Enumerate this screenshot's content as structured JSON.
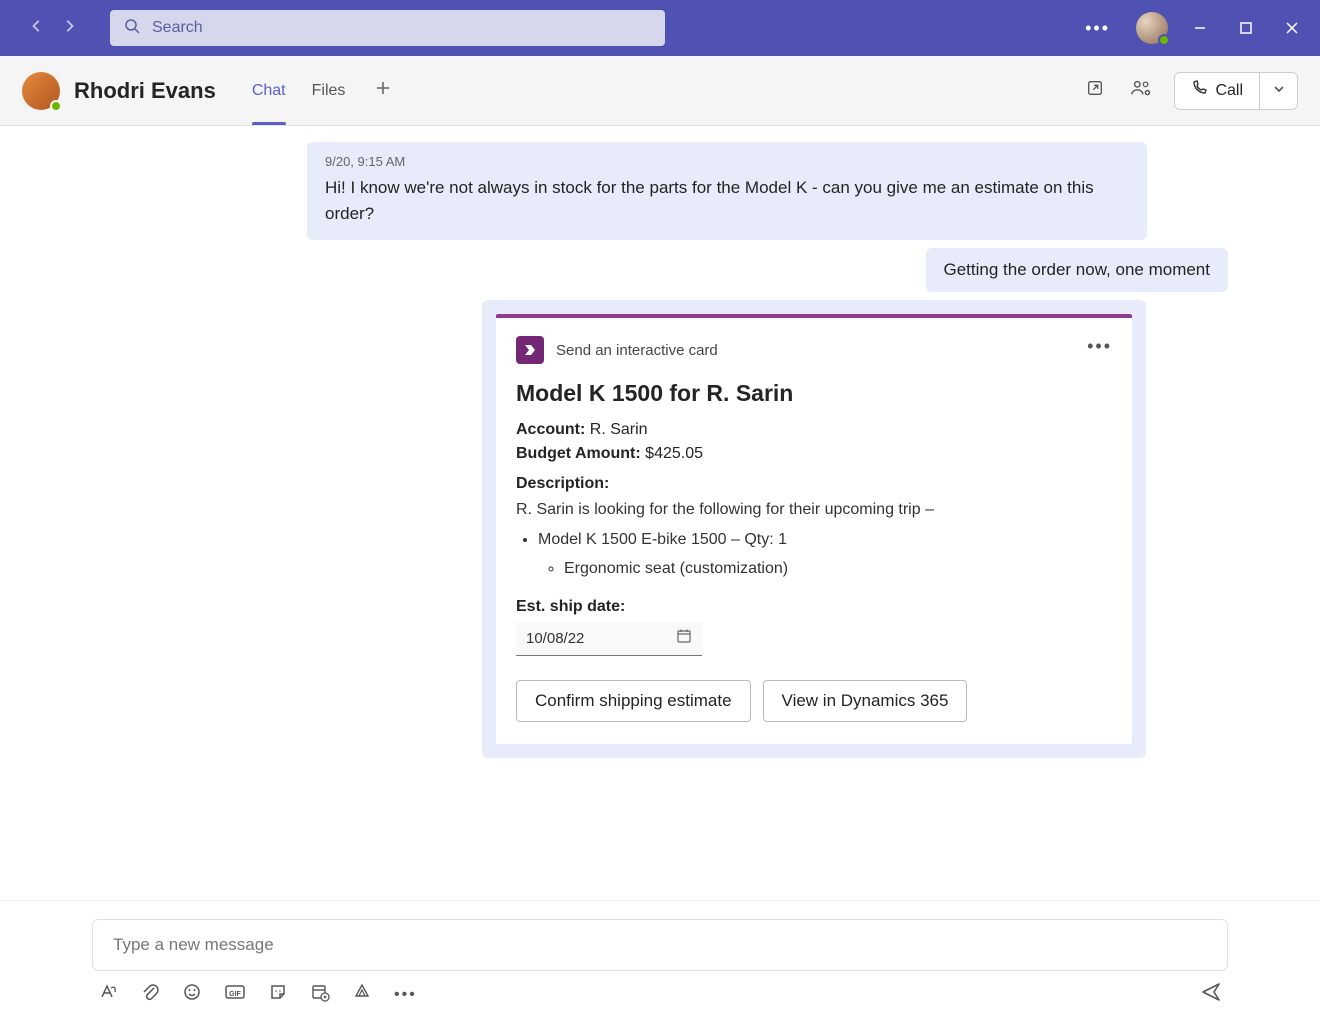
{
  "titlebar": {
    "search_placeholder": "Search"
  },
  "header": {
    "contact_name": "Rhodri Evans",
    "tabs": {
      "chat": "Chat",
      "files": "Files"
    },
    "call_label": "Call"
  },
  "messages": {
    "in1_time": "9/20, 9:15 AM",
    "in1_body": "Hi! I know we're not always in stock for the parts for the Model K - can you give me an estimate on this order?",
    "out1_body": "Getting the order now, one moment"
  },
  "card": {
    "app_name": "Send an interactive card",
    "title": "Model K 1500 for R. Sarin",
    "account_label": "Account:",
    "account_value": " R. Sarin",
    "budget_label": "Budget Amount:",
    "budget_value": " $425.05",
    "desc_label": "Description:",
    "desc_intro": "R. Sarin is looking for the following for their upcoming trip –",
    "item1": "Model K 1500 E-bike 1500 – Qty: 1",
    "item1a": "Ergonomic seat (customization)",
    "ship_label": "Est. ship date:",
    "ship_date": "10/08/22",
    "btn_confirm": "Confirm shipping estimate",
    "btn_view": "View in Dynamics 365"
  },
  "composer": {
    "placeholder": "Type a new message"
  }
}
